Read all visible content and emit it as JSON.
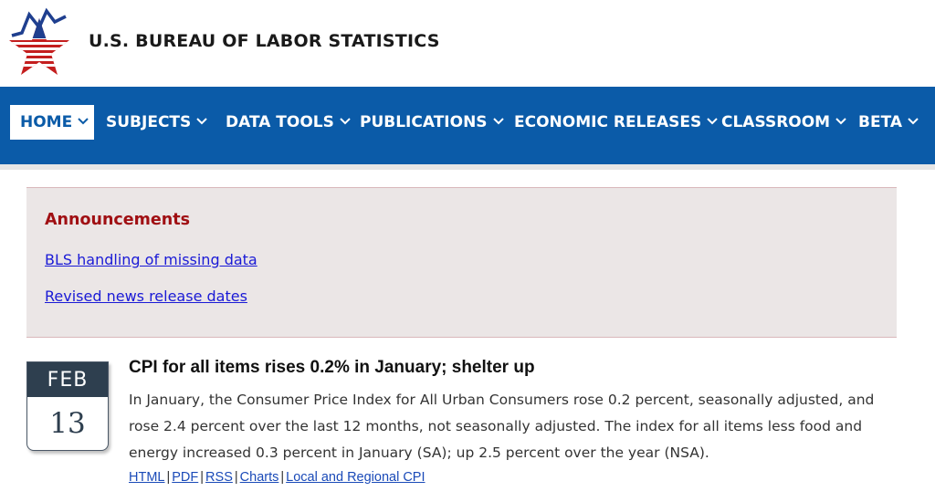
{
  "header": {
    "agency_name": "U.S. BUREAU OF LABOR STATISTICS",
    "logo_icon": "bls-star-logo-icon"
  },
  "nav": {
    "items": [
      {
        "label": "HOME",
        "active": true
      },
      {
        "label": "SUBJECTS"
      },
      {
        "label": "DATA TOOLS"
      },
      {
        "label": "PUBLICATIONS"
      },
      {
        "label": "ECONOMIC RELEASES"
      },
      {
        "label": "CLASSROOM"
      },
      {
        "label": "BETA"
      }
    ]
  },
  "announcements": {
    "heading": "Announcements",
    "links": [
      "BLS handling of missing data",
      "Revised news release dates"
    ]
  },
  "release": {
    "month": "FEB",
    "day": "13",
    "title": "CPI for all items rises 0.2% in January; shelter up",
    "body": "In January, the Consumer Price Index for All Urban Consumers rose 0.2 percent, seasonally adjusted, and rose 2.4 percent over the last 12 months, not seasonally adjusted. The index for all items less food and energy increased 0.3 percent in January (SA); up 2.5 percent over the year (NSA).",
    "links": [
      "HTML",
      "PDF",
      "RSS",
      "Charts",
      "Local and Regional CPI"
    ],
    "separator": "|"
  },
  "colors": {
    "nav_bg": "#0b5ba8",
    "announce_heading": "#a00f13",
    "link": "#1a1ad6",
    "calendar_dark": "#2e3f4f"
  }
}
